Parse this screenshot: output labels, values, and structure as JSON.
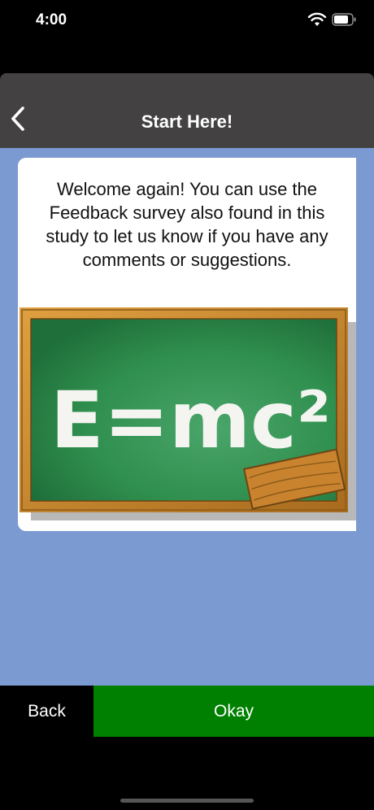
{
  "status_bar": {
    "time": "4:00"
  },
  "nav": {
    "title": "Start Here!"
  },
  "card": {
    "message": "Welcome again! You can use the Feedback survey also found in this study to let us know if you have any comments or suggestions.",
    "image_text": "E=mc²"
  },
  "buttons": {
    "back_label": "Back",
    "okay_label": "Okay"
  },
  "colors": {
    "content_bg": "#7c9ad2",
    "nav_bg": "#434142",
    "okay_bg": "#008000",
    "chalkboard_green": "#2f8f4e",
    "frame_wood": "#c8862b"
  }
}
